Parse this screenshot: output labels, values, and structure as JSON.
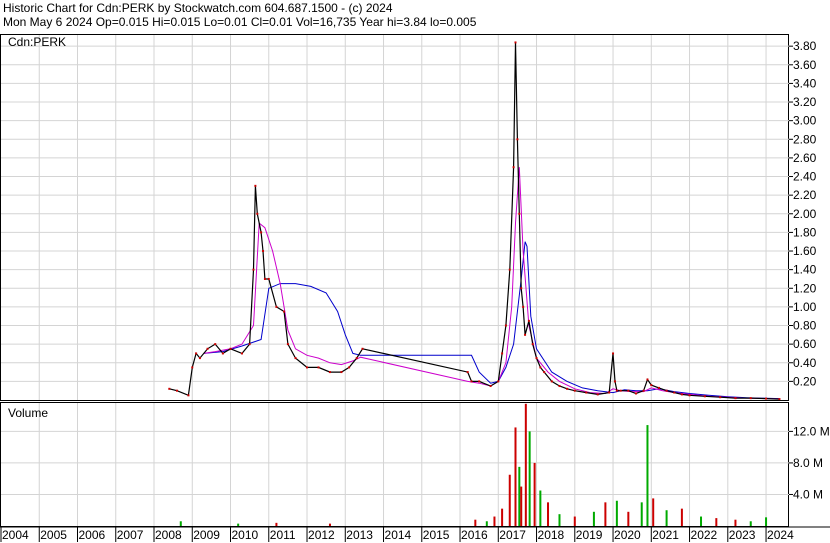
{
  "header": {
    "line1": "Historic Chart for Cdn:PERK by Stockwatch.com 604.687.1500 - (c) 2024",
    "line2": "Mon May  6 2024   Op=0.015   Hi=0.015   Lo=0.01   Cl=0.01   Vol=16,735   Year hi=3.84   lo=0.005"
  },
  "chart_data": [
    {
      "type": "line",
      "title": "Cdn:PERK",
      "y_ticks": [
        "0.20",
        "0.40",
        "0.60",
        "0.80",
        "1.00",
        "1.20",
        "1.40",
        "1.60",
        "1.80",
        "2.00",
        "2.20",
        "2.40",
        "2.60",
        "2.80",
        "3.00",
        "3.20",
        "3.40",
        "3.60",
        "3.80"
      ],
      "ylim": [
        0,
        3.92
      ],
      "xlim": [
        2004,
        2024.6
      ],
      "grid": true,
      "colors": {
        "price": "#000000",
        "dots": "#cc0000",
        "ma_short": "#cc00cc",
        "ma_long": "#0000cc"
      },
      "series": [
        {
          "key": "price",
          "x": [
            2008.4,
            2008.6,
            2008.9,
            2009.0,
            2009.1,
            2009.2,
            2009.4,
            2009.6,
            2009.8,
            2010.0,
            2010.3,
            2010.5,
            2010.6,
            2010.65,
            2010.7,
            2010.8,
            2010.85,
            2010.9,
            2011.0,
            2011.2,
            2011.4,
            2011.5,
            2011.7,
            2012.0,
            2012.3,
            2012.6,
            2012.9,
            2013.1,
            2013.3,
            2013.45,
            2016.2,
            2016.3,
            2016.5,
            2016.8,
            2017.0,
            2017.1,
            2017.2,
            2017.3,
            2017.4,
            2017.45,
            2017.5,
            2017.55,
            2017.6,
            2017.65,
            2017.7,
            2017.8,
            2017.9,
            2018.0,
            2018.1,
            2018.2,
            2018.4,
            2018.6,
            2018.8,
            2019.0,
            2019.3,
            2019.6,
            2019.9,
            2020.0,
            2020.05,
            2020.1,
            2020.2,
            2020.4,
            2020.6,
            2020.8,
            2020.9,
            2021.0,
            2021.2,
            2021.4,
            2021.6,
            2021.8,
            2022.0,
            2022.4,
            2022.8,
            2023.2,
            2023.6,
            2024.0,
            2024.35
          ],
          "y": [
            0.12,
            0.1,
            0.05,
            0.35,
            0.5,
            0.45,
            0.55,
            0.6,
            0.5,
            0.55,
            0.5,
            0.6,
            1.4,
            2.3,
            2.0,
            1.8,
            1.6,
            1.3,
            1.3,
            1.0,
            0.95,
            0.6,
            0.45,
            0.35,
            0.35,
            0.3,
            0.3,
            0.35,
            0.45,
            0.55,
            0.3,
            0.2,
            0.2,
            0.15,
            0.2,
            0.5,
            0.8,
            1.4,
            2.5,
            3.84,
            2.8,
            2.0,
            1.2,
            1.0,
            0.7,
            0.85,
            0.6,
            0.45,
            0.35,
            0.3,
            0.2,
            0.15,
            0.12,
            0.1,
            0.08,
            0.06,
            0.08,
            0.5,
            0.2,
            0.1,
            0.1,
            0.1,
            0.07,
            0.1,
            0.22,
            0.16,
            0.13,
            0.1,
            0.08,
            0.06,
            0.05,
            0.04,
            0.03,
            0.02,
            0.02,
            0.015,
            0.01
          ]
        },
        {
          "key": "ma_short",
          "x": [
            2009.3,
            2009.6,
            2010.0,
            2010.3,
            2010.6,
            2010.75,
            2010.9,
            2011.1,
            2011.3,
            2011.5,
            2011.7,
            2012.0,
            2012.3,
            2012.6,
            2012.9,
            2013.2,
            2013.4,
            2016.2,
            2016.5,
            2016.8,
            2017.0,
            2017.2,
            2017.35,
            2017.45,
            2017.55,
            2017.65,
            2017.8,
            2018.0,
            2018.3,
            2018.6,
            2019.0,
            2019.4,
            2019.8,
            2020.0,
            2020.2,
            2020.5,
            2020.8,
            2021.0,
            2021.3,
            2021.6,
            2022.0,
            2022.5,
            2023.0,
            2023.5,
            2024.0,
            2024.35
          ],
          "y": [
            0.5,
            0.52,
            0.55,
            0.6,
            0.8,
            1.9,
            1.85,
            1.6,
            1.25,
            0.75,
            0.55,
            0.48,
            0.45,
            0.4,
            0.38,
            0.42,
            0.46,
            0.2,
            0.18,
            0.15,
            0.2,
            0.4,
            1.0,
            1.9,
            2.5,
            1.6,
            0.8,
            0.45,
            0.3,
            0.2,
            0.12,
            0.08,
            0.07,
            0.12,
            0.1,
            0.09,
            0.09,
            0.13,
            0.1,
            0.08,
            0.06,
            0.04,
            0.03,
            0.02,
            0.015,
            0.012
          ]
        },
        {
          "key": "ma_long",
          "x": [
            2009.3,
            2009.8,
            2010.3,
            2010.8,
            2011.0,
            2011.3,
            2011.7,
            2012.1,
            2012.5,
            2012.8,
            2013.0,
            2013.2,
            2013.4,
            2016.3,
            2016.5,
            2016.8,
            2017.0,
            2017.2,
            2017.4,
            2017.6,
            2017.7,
            2017.75,
            2017.85,
            2018.0,
            2018.4,
            2018.8,
            2019.2,
            2019.6,
            2020.0,
            2020.3,
            2020.6,
            2020.9,
            2021.2,
            2021.6,
            2022.0,
            2022.5,
            2023.0,
            2023.5,
            2024.0,
            2024.35
          ],
          "y": [
            0.5,
            0.52,
            0.58,
            0.65,
            1.2,
            1.25,
            1.25,
            1.22,
            1.15,
            0.95,
            0.7,
            0.5,
            0.48,
            0.48,
            0.3,
            0.18,
            0.2,
            0.35,
            0.6,
            1.3,
            1.7,
            1.65,
            0.9,
            0.55,
            0.3,
            0.2,
            0.13,
            0.1,
            0.08,
            0.11,
            0.1,
            0.1,
            0.12,
            0.09,
            0.07,
            0.05,
            0.035,
            0.025,
            0.018,
            0.015
          ]
        }
      ]
    },
    {
      "type": "bar",
      "title": "Volume",
      "y_ticks": [
        "4.0 M",
        "8.0 M",
        "12.0 M"
      ],
      "ylim": [
        0,
        15.6
      ],
      "colors": {
        "up": "#00aa00",
        "down": "#cc0000"
      },
      "bars": [
        {
          "x": 2008.7,
          "v": 0.6,
          "c": "up"
        },
        {
          "x": 2010.2,
          "v": 0.3,
          "c": "up"
        },
        {
          "x": 2011.2,
          "v": 0.4,
          "c": "down"
        },
        {
          "x": 2012.6,
          "v": 0.3,
          "c": "down"
        },
        {
          "x": 2016.4,
          "v": 0.8,
          "c": "down"
        },
        {
          "x": 2016.7,
          "v": 0.6,
          "c": "up"
        },
        {
          "x": 2016.9,
          "v": 1.2,
          "c": "down"
        },
        {
          "x": 2017.1,
          "v": 2.2,
          "c": "down"
        },
        {
          "x": 2017.3,
          "v": 6.5,
          "c": "down"
        },
        {
          "x": 2017.45,
          "v": 12.5,
          "c": "down"
        },
        {
          "x": 2017.55,
          "v": 7.5,
          "c": "up"
        },
        {
          "x": 2017.6,
          "v": 5.0,
          "c": "down"
        },
        {
          "x": 2017.72,
          "v": 15.5,
          "c": "down"
        },
        {
          "x": 2017.82,
          "v": 12.0,
          "c": "up"
        },
        {
          "x": 2017.95,
          "v": 8.0,
          "c": "down"
        },
        {
          "x": 2018.1,
          "v": 4.5,
          "c": "up"
        },
        {
          "x": 2018.3,
          "v": 3.0,
          "c": "down"
        },
        {
          "x": 2018.6,
          "v": 1.5,
          "c": "up"
        },
        {
          "x": 2019.0,
          "v": 1.2,
          "c": "down"
        },
        {
          "x": 2019.5,
          "v": 1.8,
          "c": "up"
        },
        {
          "x": 2019.8,
          "v": 3.0,
          "c": "down"
        },
        {
          "x": 2020.1,
          "v": 3.2,
          "c": "up"
        },
        {
          "x": 2020.4,
          "v": 1.8,
          "c": "down"
        },
        {
          "x": 2020.75,
          "v": 3.0,
          "c": "up"
        },
        {
          "x": 2020.9,
          "v": 12.8,
          "c": "up"
        },
        {
          "x": 2021.05,
          "v": 3.5,
          "c": "down"
        },
        {
          "x": 2021.4,
          "v": 2.0,
          "c": "up"
        },
        {
          "x": 2021.8,
          "v": 2.2,
          "c": "down"
        },
        {
          "x": 2022.3,
          "v": 1.2,
          "c": "up"
        },
        {
          "x": 2022.7,
          "v": 1.0,
          "c": "down"
        },
        {
          "x": 2023.2,
          "v": 0.8,
          "c": "down"
        },
        {
          "x": 2023.6,
          "v": 0.6,
          "c": "up"
        },
        {
          "x": 2024.0,
          "v": 1.1,
          "c": "up"
        }
      ]
    }
  ],
  "x_axis": {
    "labels": [
      "2004",
      "2005",
      "2006",
      "2007",
      "2008",
      "2009",
      "2010",
      "2011",
      "2012",
      "2013",
      "2014",
      "2015",
      "2016",
      "2017",
      "2018",
      "2019",
      "2020",
      "2021",
      "2022",
      "2023",
      "2024"
    ]
  }
}
